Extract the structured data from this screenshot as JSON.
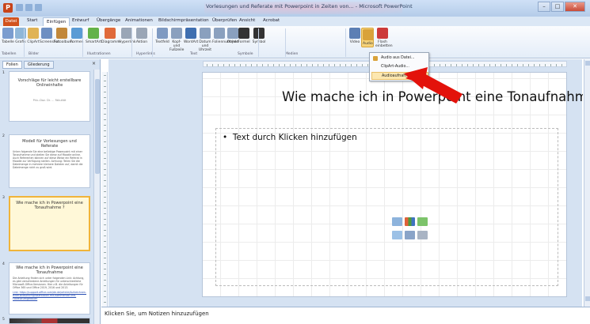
{
  "window": {
    "app_icon_letter": "P",
    "title": "Vorlesungen und Referate mit Powerpoint in Zeiten von... - Microsoft PowerPoint",
    "controls": [
      "–",
      "□",
      "✕"
    ]
  },
  "tabs": {
    "file": "Datei",
    "items": [
      "Start",
      "Einfügen",
      "Entwurf",
      "Übergänge",
      "Animationen",
      "Bildschirmpräsentation",
      "Überprüfen",
      "Ansicht",
      "Acrobat"
    ],
    "active": "Einfügen"
  },
  "ribbon": {
    "buttons": [
      {
        "label": "Tabelle",
        "icon": "table-icon",
        "color": "#7a9ccf"
      },
      {
        "label": "Grafik",
        "icon": "picture-icon",
        "color": "#8fb6d8"
      },
      {
        "label": "ClipArt",
        "icon": "clipart-icon",
        "color": "#e0b354"
      },
      {
        "label": "Screenshot",
        "icon": "screenshot-icon",
        "color": "#6d8fc2"
      },
      {
        "label": "Fotoalbum",
        "icon": "photo-album-icon",
        "color": "#c2883a"
      },
      {
        "label": "Formen",
        "icon": "shapes-icon",
        "color": "#5a9bd5"
      },
      {
        "label": "SmartArt",
        "icon": "smartart-icon",
        "color": "#63b249"
      },
      {
        "label": "Diagramm",
        "icon": "chart-icon",
        "color": "#e06a3a"
      },
      {
        "label": "Hyperlink",
        "icon": "hyperlink-icon",
        "color": "#9aa6b6"
      },
      {
        "label": "Aktion",
        "icon": "action-icon",
        "color": "#9aa6b6"
      },
      {
        "label": "Textfeld",
        "icon": "textbox-icon",
        "color": "#7f9ac2"
      },
      {
        "label": "Kopf- und Fußzeile",
        "icon": "header-footer-icon",
        "color": "#8aa0be"
      },
      {
        "label": "WordArt",
        "icon": "wordart-icon",
        "color": "#3f6fb0"
      },
      {
        "label": "Datum und Uhrzeit",
        "icon": "date-time-icon",
        "color": "#8aa0be"
      },
      {
        "label": "Foliennummer",
        "icon": "slide-number-icon",
        "color": "#8aa0be"
      },
      {
        "label": "Objekt",
        "icon": "object-icon",
        "color": "#8aa0be"
      },
      {
        "label": "Formel",
        "icon": "formula-icon",
        "color": "#333"
      },
      {
        "label": "Symbol",
        "icon": "symbol-icon",
        "color": "#333"
      },
      {
        "label": "Video",
        "icon": "video-icon",
        "color": "#5c7fb4"
      },
      {
        "label": "Audio",
        "icon": "audio-icon",
        "color": "#d9a23a"
      },
      {
        "label": "Flash einbetten",
        "icon": "flash-icon",
        "color": "#cc3a3a"
      }
    ],
    "groups": [
      "Tabellen",
      "Bilder",
      "Illustrationen",
      "Hyperlinks",
      "Text",
      "Symbole",
      "Medien"
    ]
  },
  "left_panel": {
    "tabs": [
      "Folien",
      "Gliederung"
    ],
    "close": "×",
    "slides": [
      {
        "num": "1",
        "title": "Vorschläge für leicht erstellbare Onlineinhalte",
        "sub": "Priv.-Doz. Dr. ... Fakultät"
      },
      {
        "num": "2",
        "title": "Modell für Vorlesungen und Referate",
        "text": "Unten folgende Sie eine beliebige Powerpoint mit einer Tonaufnahme und stellen Sie diese auf Moodle online. Auch Referenten können auf diese Weise ein Referat in Moodle zur Verfügung stellen. Achtung: Teilen Sie die Dateimenge in mehrere kleinere Dateien auf, damit die Dateimenge nicht zu groß wird."
      },
      {
        "num": "3",
        "title": "Wie mache ich in Powerpoint eine Tonaufnahme ?"
      },
      {
        "num": "4",
        "title": "Wie mache ich in Powerpoint eine Tonaufnahme",
        "text": "Die Anleitung finden sich unter folgenden Link: Achtung, es gibt verschiedene Anleitungen für unterschiedliche Microsoft-Office-Versionen. Hier z.B. die Anleitungen für Office 365 und Office 2019, 2016 und 2013.",
        "link": "Link: https://support.office.com/de-de/article/Aufzeichnen-einer-Bildschirmpräsentation-mit-Kommentar-und-Folienanzeigedauer"
      },
      {
        "num": "5"
      }
    ]
  },
  "slide": {
    "title": "Wie mache ich in Powerpoint eine Tonaufnahme ?",
    "placeholder": "Text durch Klicken hinzufügen"
  },
  "notes": {
    "placeholder": "Klicken Sie, um Notizen hinzuzufügen"
  },
  "audio_menu": {
    "items": [
      {
        "label": "Audio aus Datei...",
        "icon": "audio-file-icon",
        "color": "#d9a23a"
      },
      {
        "label": "ClipArt-Audio...",
        "icon": "clipart-audio-icon",
        "color": "#ffffff"
      },
      {
        "label": "Audioaufnahme...",
        "icon": "record-audio-icon",
        "color": "#ffffff"
      }
    ],
    "highlighted_index": 2
  },
  "colors": {
    "accent_file_tab": "#d2521d",
    "arrow": "#e3120b",
    "selection": "#f0b43a"
  }
}
